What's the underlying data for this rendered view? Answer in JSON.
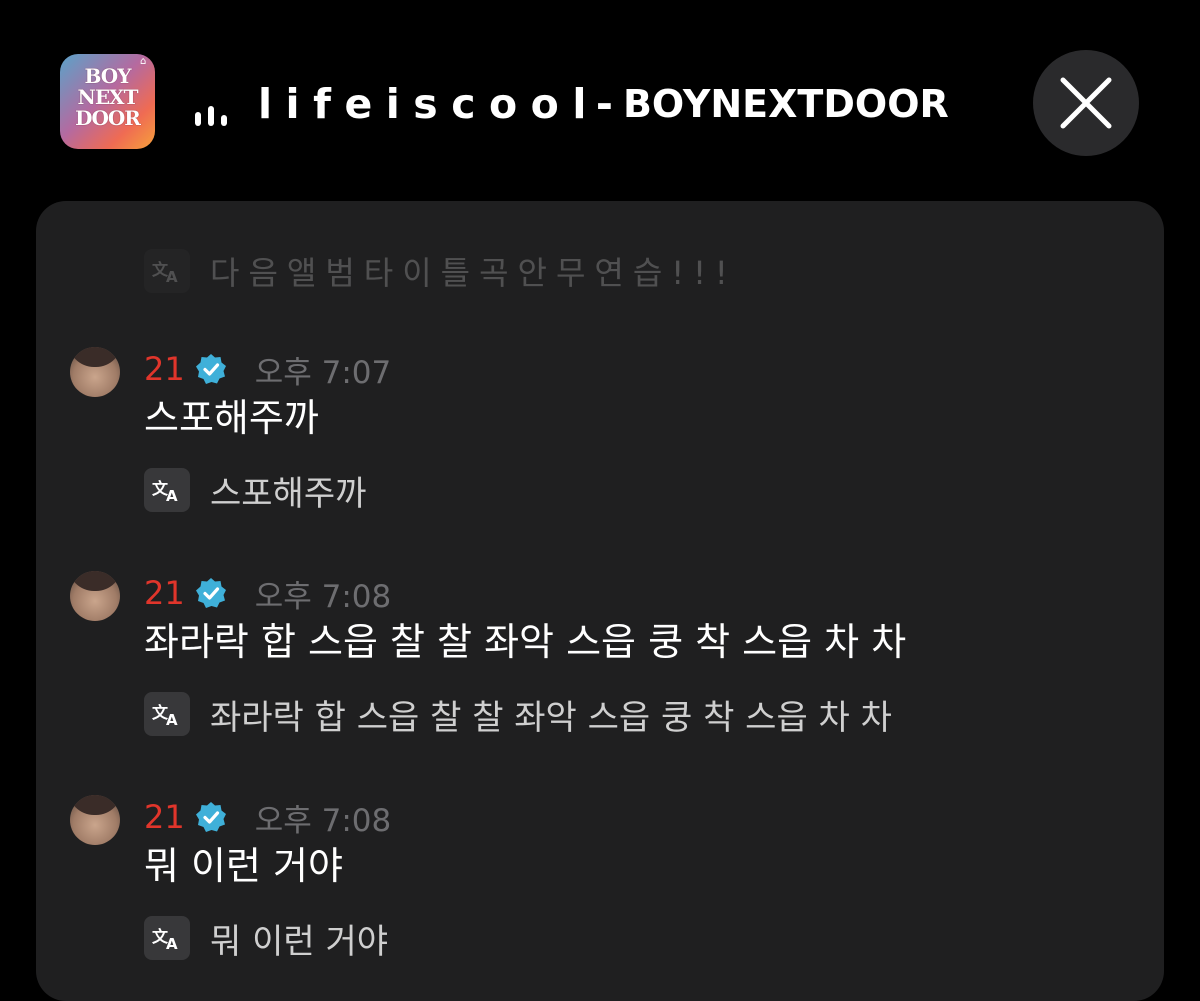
{
  "header": {
    "app_icon_text_line1": "BOY",
    "app_icon_text_line2": "NEXT",
    "app_icon_text_line3": "DOOR",
    "song_title": "lifeiscool",
    "separator": "-",
    "artist": "BOYNEXTDOOR",
    "close_icon": "close-icon",
    "equalizer_icon": "audio-bars-icon"
  },
  "chat": {
    "faded_translation": "다음앨범타이틀곡안무연습!!!",
    "messages": [
      {
        "username": "21",
        "time": "오후 7:07",
        "text": "스포해주까",
        "translation": "스포해주까"
      },
      {
        "username": "21",
        "time": "오후 7:08",
        "text": "좌라락 합 스읍 찰 찰 좌악 스읍 쿵 착 스읍 차 차",
        "translation": "좌라락 합 스읍 찰 찰 좌악 스읍 쿵 착 스읍 차 차"
      },
      {
        "username": "21",
        "time": "오후 7:08",
        "text": "뭐 이런 거야",
        "translation": "뭐 이런 거야"
      }
    ]
  },
  "colors": {
    "background": "#000000",
    "panel": "#1f1f20",
    "username": "#e0352b",
    "verified": "#3fb0d9",
    "timestamp": "#6d6d70"
  }
}
